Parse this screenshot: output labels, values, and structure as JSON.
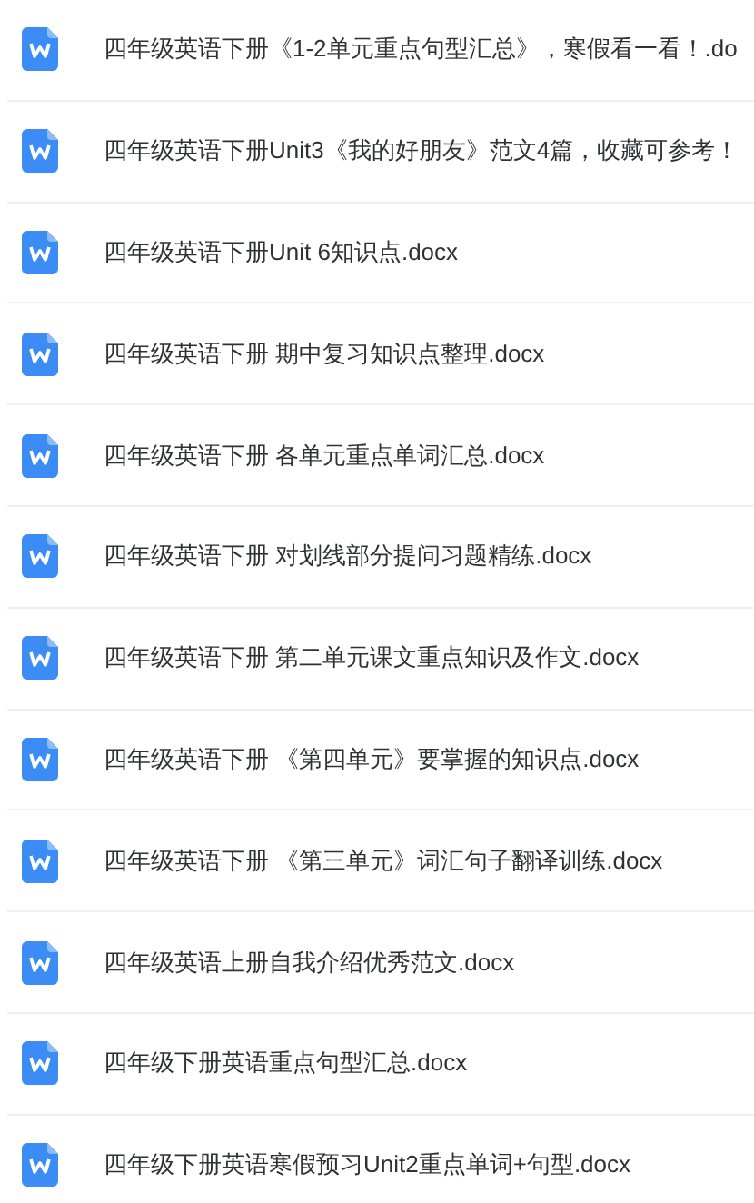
{
  "files": [
    {
      "name": "四年级英语下册《1-2单元重点句型汇总》，寒假看一看！.do"
    },
    {
      "name": "四年级英语下册Unit3《我的好朋友》范文4篇，收藏可参考！"
    },
    {
      "name": "四年级英语下册Unit 6知识点.docx"
    },
    {
      "name": "四年级英语下册 期中复习知识点整理.docx"
    },
    {
      "name": "四年级英语下册 各单元重点单词汇总.docx"
    },
    {
      "name": "四年级英语下册 对划线部分提问习题精练.docx"
    },
    {
      "name": "四年级英语下册 第二单元课文重点知识及作文.docx"
    },
    {
      "name": "四年级英语下册 《第四单元》要掌握的知识点.docx"
    },
    {
      "name": "四年级英语下册 《第三单元》词汇句子翻译训练.docx"
    },
    {
      "name": "四年级英语上册自我介绍优秀范文.docx"
    },
    {
      "name": "四年级下册英语重点句型汇总.docx"
    },
    {
      "name": "四年级下册英语寒假预习Unit2重点单词+句型.docx"
    }
  ]
}
